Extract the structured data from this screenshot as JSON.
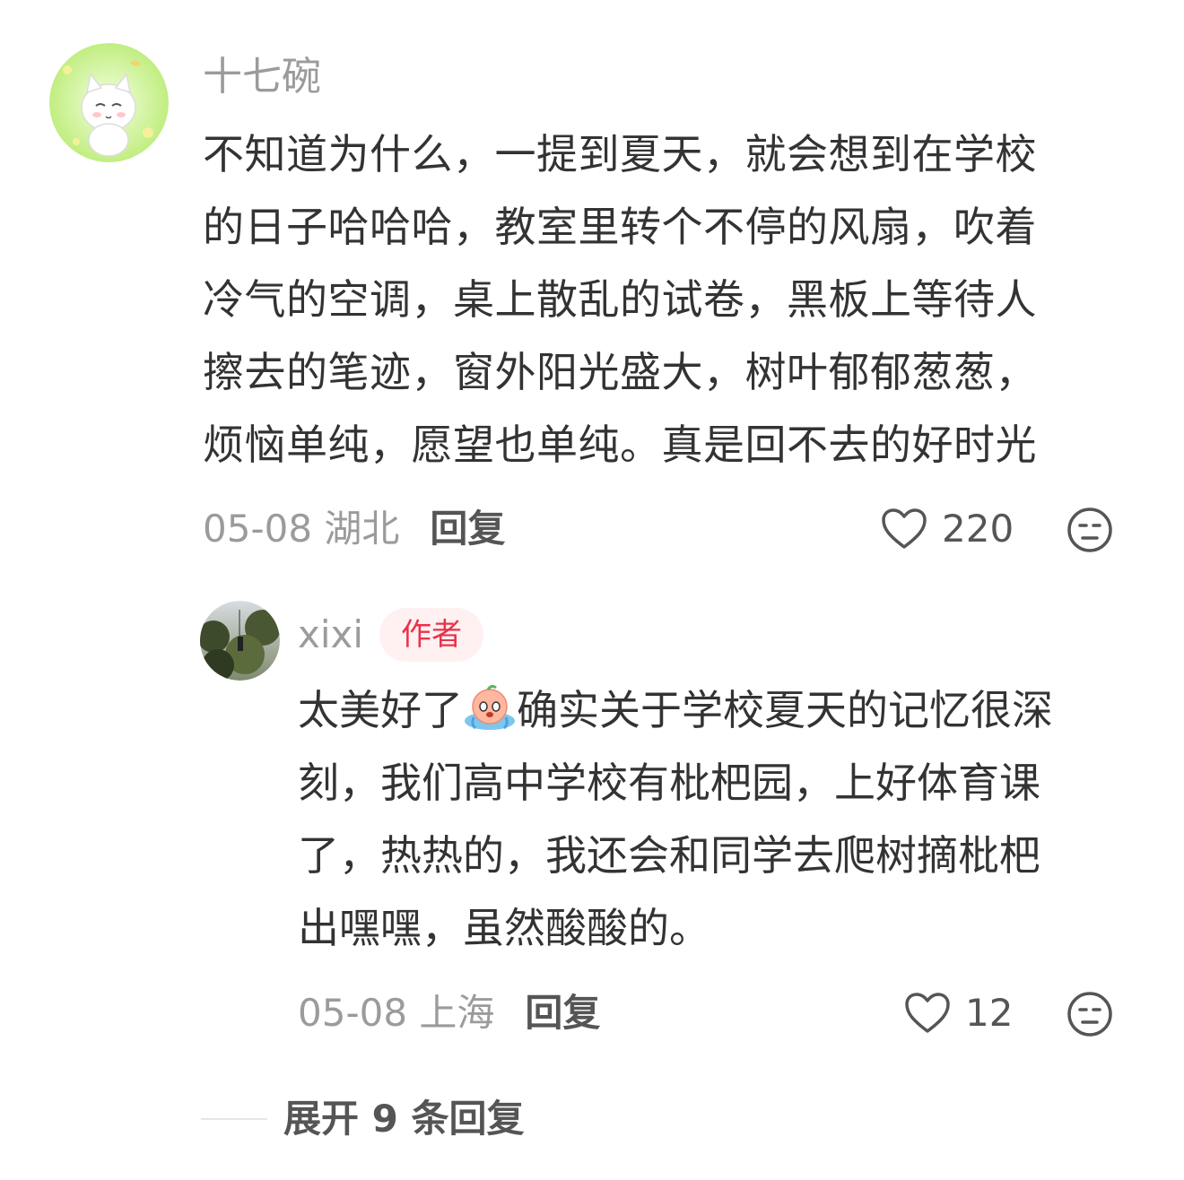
{
  "comment": {
    "username": "十七碗",
    "avatar_icon": "cat-avatar-icon",
    "content_lines": [
      "不知道为什么，一提到夏天，就会想到在学校",
      "的日子哈哈哈，教室里转个不停的风扇，吹着",
      "冷气的空调，桌上散乱的试卷，黑板上等待人",
      "擦去的笔迹，窗外阳光盛大，树叶郁郁葱葱，",
      "烦恼单纯，愿望也单纯。真是回不去的好时光"
    ],
    "date_location": "05-08 湖北",
    "reply_label": "回复",
    "like_count": "220"
  },
  "reply": {
    "username": "xixi",
    "badge": "作者",
    "avatar_icon": "tree-photo-avatar",
    "content_line1_before_emoji": "太美好了",
    "inline_emoji": "crying-emoji-icon",
    "content_line1_after_emoji": "确实关于学校夏天的记忆很深",
    "content_lines_rest": [
      "刻，我们高中学校有枇杷园，上好体育课",
      "了，热热的，我还会和同学去爬树摘枇杷",
      "出嘿嘿，虽然酸酸的。"
    ],
    "date_location": "05-08 上海",
    "reply_label": "回复",
    "like_count": "12"
  },
  "expand": {
    "label": "展开 9 条回复"
  },
  "colors": {
    "text": "#333333",
    "muted": "#9b9b9b",
    "badge_text": "#e8334a",
    "badge_bg": "#fff0f1"
  }
}
